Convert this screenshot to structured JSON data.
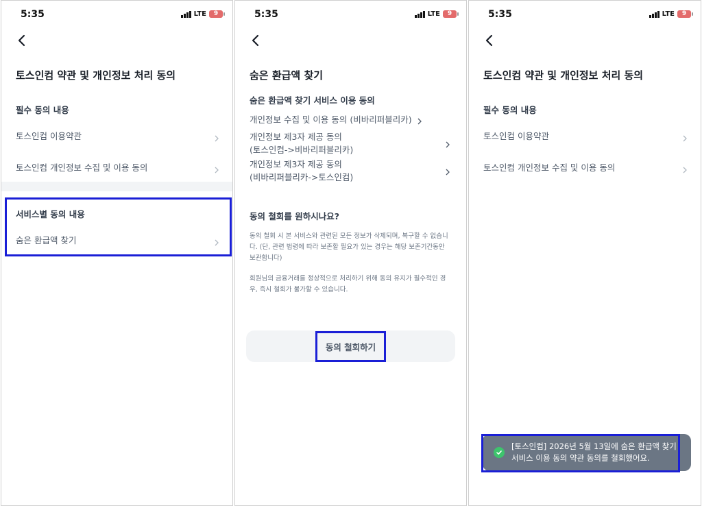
{
  "status": {
    "time": "5:35",
    "network": "LTE",
    "battery": "9"
  },
  "screen1": {
    "title": "토스인컴 약관 및 개인정보 처리 동의",
    "required_heading": "필수 동의 내용",
    "required_items": [
      {
        "label": "토스인컴 이용약관"
      },
      {
        "label": "토스인컴 개인정보 수집 및 이용 동의"
      }
    ],
    "service_heading": "서비스별 동의 내용",
    "service_items": [
      {
        "label": "숨은 환급액 찾기"
      }
    ]
  },
  "screen2": {
    "title": "숨은 환급액 찾기",
    "subtitle": "숨은 환급액 찾기 서비스 이용 동의",
    "links": [
      {
        "line1": "개인정보 수집 및 이용 동의 (비바리퍼블리카)",
        "line2": ""
      },
      {
        "line1": "개인정보 제3자 제공 동의",
        "line2": "(토스인컴->비바리퍼블리카)"
      },
      {
        "line1": "개인정보 제3자 제공 동의",
        "line2": "(비바리퍼블리카->토스인컴)"
      }
    ],
    "question": "동의 철회를 원하시나요?",
    "para1": "동의 철회 시 본 서비스와 관련된 모든 정보가 삭제되며, 복구할 수 없습니다. (단, 관련 법령에 따라 보존할 필요가 있는 경우는 해당 보존기간동안 보관합니다)",
    "para2": "회원님의 금융거래를 정상적으로 처리하기 위해 동의 유지가 필수적인 경우, 즉시 철회가 불가할 수 있습니다.",
    "withdraw_button": "동의 철회하기"
  },
  "screen3": {
    "title": "토스인컴 약관 및 개인정보 처리 동의",
    "required_heading": "필수 동의 내용",
    "required_items": [
      {
        "label": "토스인컴 이용약관"
      },
      {
        "label": "토스인컴 개인정보 수집 및 이용 동의"
      }
    ],
    "toast": {
      "line1": "[토스인컴] 2026년 5월 13일에 숨은 환급액 찾기",
      "line2": "서비스 이용 동의 약관 동의를 철회했어요."
    }
  },
  "colors": {
    "highlight": "#1a1fd6",
    "toast_bg": "#6b7684",
    "check": "#3ec46d"
  }
}
